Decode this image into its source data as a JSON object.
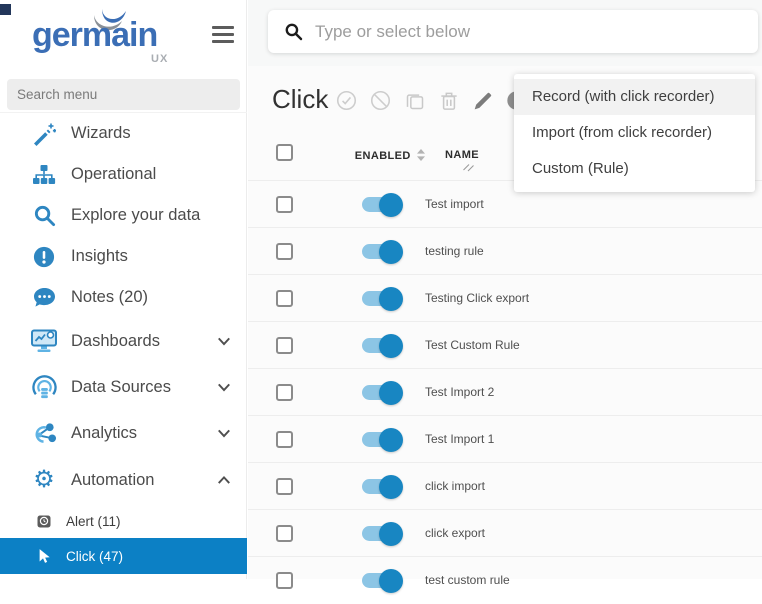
{
  "logo": {
    "text": "germain",
    "sub": "UX"
  },
  "sidebar": {
    "search": {
      "placeholder": "Search menu"
    },
    "items": [
      {
        "label": "Wizards",
        "icon": "magic-wand-icon"
      },
      {
        "label": "Operational",
        "icon": "sitemap-icon"
      },
      {
        "label": "Explore your data",
        "icon": "search-icon"
      },
      {
        "label": "Insights",
        "icon": "exclamation-circle-icon"
      },
      {
        "label": "Notes (20)",
        "icon": "comments-icon"
      },
      {
        "label": "Dashboards",
        "icon": "dashboard-icon",
        "expandable": true,
        "state": "collapsed"
      },
      {
        "label": "Data Sources",
        "icon": "database-icon",
        "expandable": true,
        "state": "collapsed"
      },
      {
        "label": "Analytics",
        "icon": "share-nodes-icon",
        "expandable": true,
        "state": "collapsed"
      },
      {
        "label": "Automation",
        "icon": "gear-icon",
        "expandable": true,
        "state": "expanded"
      }
    ],
    "automation_children": [
      {
        "label": "Alert (11)",
        "icon": "alarm-icon",
        "selected": false
      },
      {
        "label": "Click (47)",
        "icon": "cursor-icon",
        "selected": true
      }
    ]
  },
  "topbar": {
    "search_placeholder": "Type or select below"
  },
  "main": {
    "title": "Click",
    "toolbar_icons": [
      "check-circle",
      "ban",
      "copy",
      "trash",
      "pencil",
      "play-circle"
    ],
    "context_menu": {
      "items": [
        {
          "label": "Record (with click recorder)",
          "highlighted": true
        },
        {
          "label": "Import (from click recorder)",
          "highlighted": false
        },
        {
          "label": "Custom (Rule)",
          "highlighted": false
        }
      ]
    },
    "table": {
      "headers": {
        "enabled": "ENABLED",
        "name": "NAME"
      },
      "rows": [
        {
          "name": "Test import",
          "enabled": true
        },
        {
          "name": "testing rule",
          "enabled": true
        },
        {
          "name": "Testing Click export",
          "enabled": true
        },
        {
          "name": "Test Custom Rule",
          "enabled": true
        },
        {
          "name": "Test Import 2",
          "enabled": true
        },
        {
          "name": "Test Import 1",
          "enabled": true
        },
        {
          "name": "click import",
          "enabled": true
        },
        {
          "name": "click export",
          "enabled": true
        },
        {
          "name": "test custom rule",
          "enabled": true
        }
      ]
    }
  },
  "colors": {
    "logo_blue": "#3b6eb5",
    "icon_blue": "#2e86c1",
    "selected_row_bg": "#0c80c5",
    "toggle_track": "#8cc5e5",
    "toggle_knob": "#1886c2",
    "corner_square": "#22365a"
  }
}
